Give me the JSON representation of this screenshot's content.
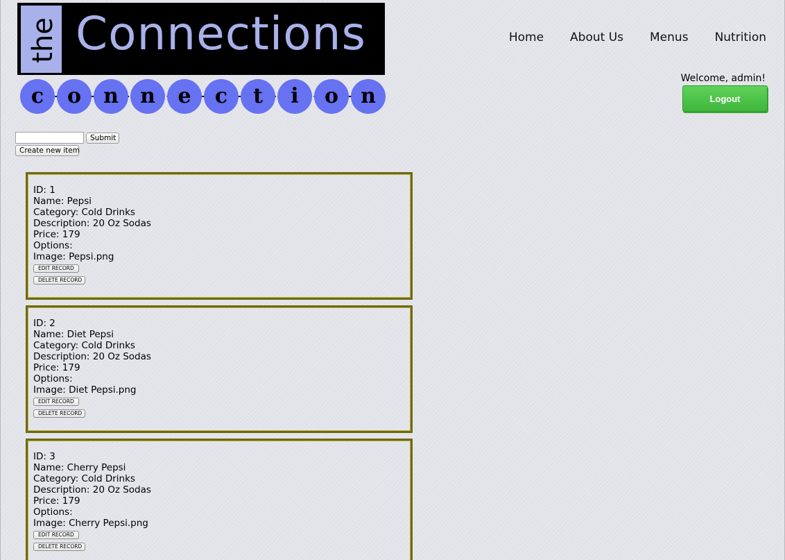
{
  "logo": {
    "the": "the",
    "title": "Connections",
    "letters": [
      "c",
      "o",
      "n",
      "n",
      "e",
      "c",
      "t",
      "i",
      "o",
      "n"
    ]
  },
  "nav": {
    "items": [
      "Home",
      "About Us",
      "Menus",
      "Nutrition"
    ]
  },
  "user": {
    "welcome": "Welcome, admin!",
    "logout_label": "Logout"
  },
  "search": {
    "value": "",
    "submit_label": "Submit",
    "create_label": "Create new item"
  },
  "labels": {
    "id": "ID: ",
    "name": "Name: ",
    "category": "Category: ",
    "description": "Description: ",
    "price": "Price: ",
    "options": "Options:",
    "image": "Image: ",
    "edit": "EDIT RECORD",
    "delete": "DELETE RECORD"
  },
  "records": [
    {
      "id": "1",
      "name": "Pepsi",
      "category": "Cold Drinks",
      "description": "20 Oz Sodas",
      "price": "179",
      "options": "",
      "image": "Pepsi.png"
    },
    {
      "id": "2",
      "name": "Diet Pepsi",
      "category": "Cold Drinks",
      "description": "20 Oz Sodas",
      "price": "179",
      "options": "",
      "image": "Diet Pepsi.png"
    },
    {
      "id": "3",
      "name": "Cherry Pepsi",
      "category": "Cold Drinks",
      "description": "20 Oz Sodas",
      "price": "179",
      "options": "",
      "image": "Cherry Pepsi.png"
    }
  ],
  "colors": {
    "logo_accent": "#a9b1ea",
    "circle_blue": "#6672f1",
    "logout_green": "#4cc447",
    "record_border": "#6e6a10"
  }
}
